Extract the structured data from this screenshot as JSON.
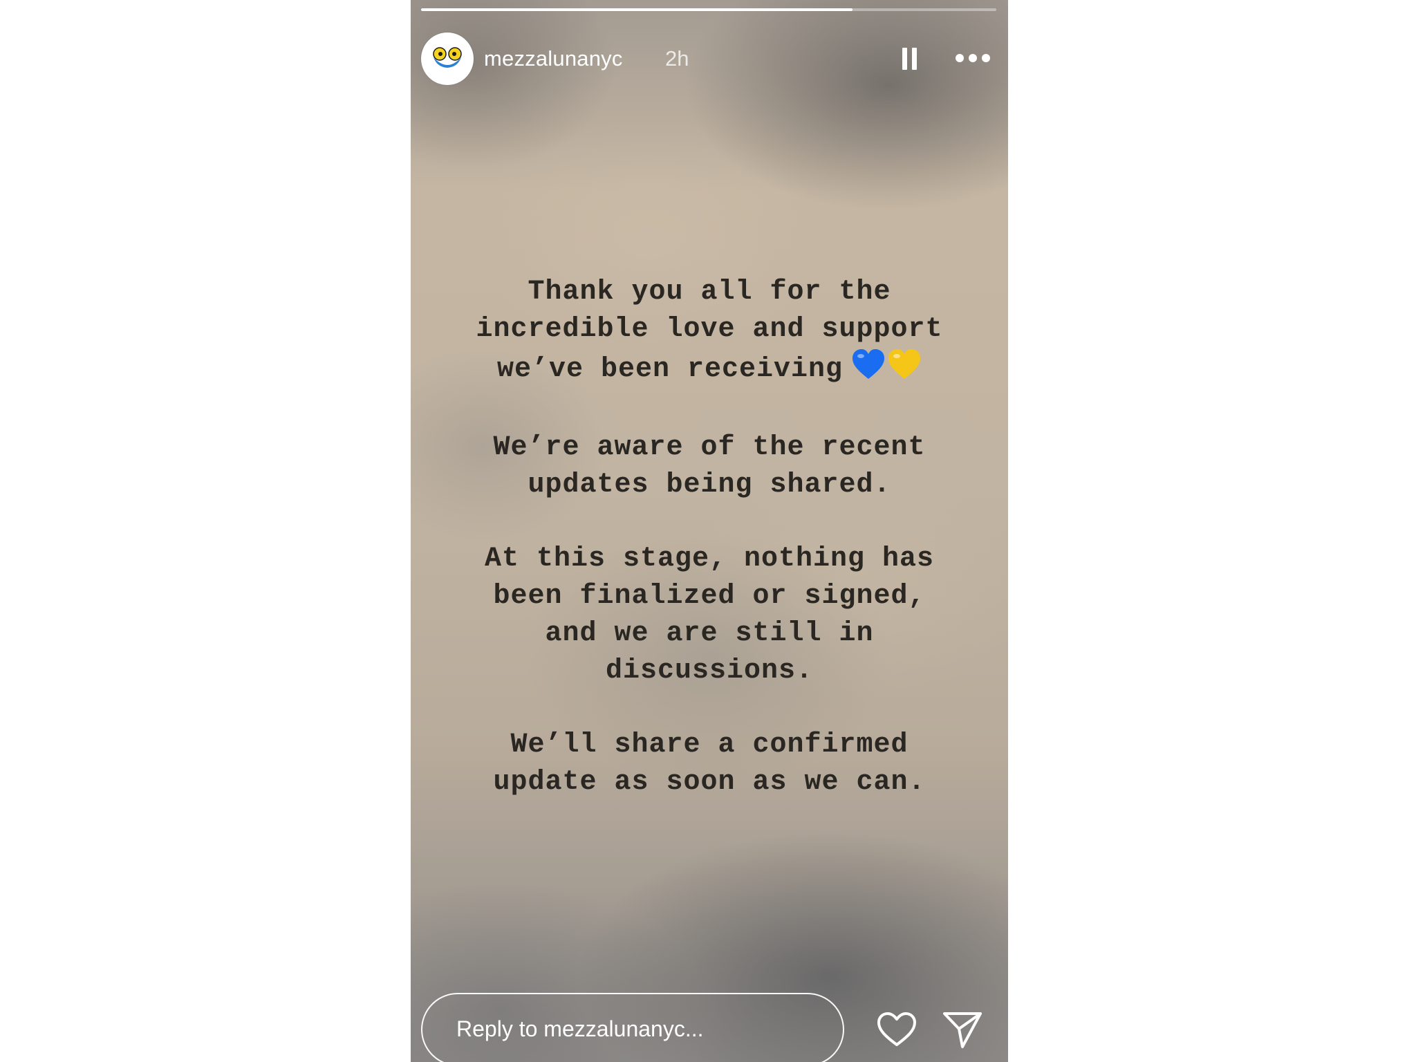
{
  "story": {
    "progress": 0.75,
    "username": "mezzalunanyc",
    "timestamp": "2h",
    "icons": {
      "avatar": "mezzaluna-logo-icon",
      "pause": "pause-icon",
      "more": "more-options-icon",
      "like": "heart-icon",
      "share": "send-icon"
    },
    "message": {
      "p1": "Thank you all for the\nincredible love and support\nwe’ve been receiving",
      "p1_emojis": [
        "blue-heart-icon",
        "yellow-heart-icon"
      ],
      "p2": "We’re aware of the recent\nupdates being shared.",
      "p3": "At this stage, nothing has\nbeen finalized or signed,\nand we are still in\ndiscussions.",
      "p4": "We’ll share a confirmed\nupdate as soon as we can."
    },
    "reply": {
      "placeholder": "Reply to mezzalunanyc..."
    },
    "colors": {
      "text": "#2a2622",
      "ui": "#ffffff",
      "blue_heart": "#1a6cf0",
      "yellow_heart": "#f5c518"
    }
  }
}
